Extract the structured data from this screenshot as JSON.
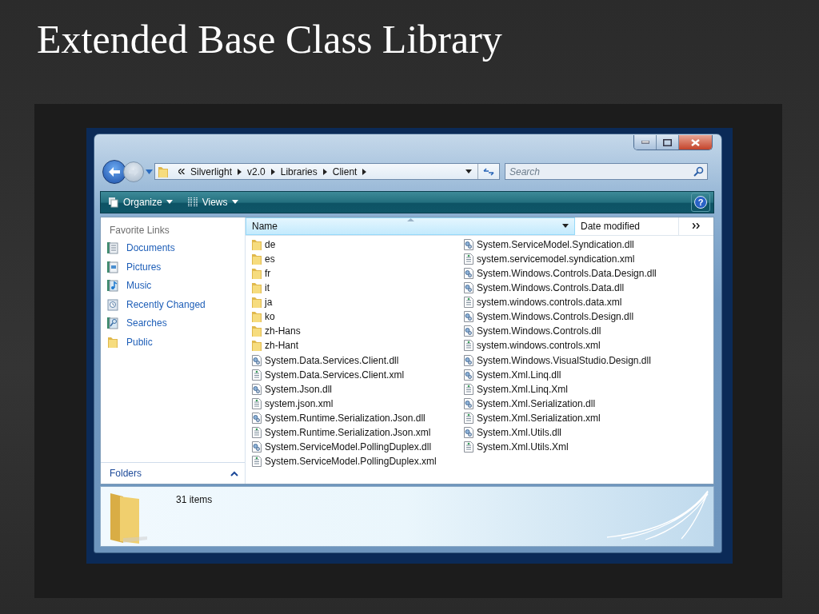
{
  "slide": {
    "title": "Extended Base Class Library"
  },
  "window": {
    "breadcrumb": [
      "Silverlight",
      "v2.0",
      "Libraries",
      "Client"
    ],
    "search": {
      "placeholder": "Search"
    },
    "help_label": "?",
    "toolbar": [
      {
        "label": "Organize",
        "kind": "organize"
      },
      {
        "label": "Views",
        "kind": "views"
      }
    ],
    "favorite_links": {
      "title": "Favorite Links",
      "items": [
        {
          "label": "Documents",
          "kind": "documents"
        },
        {
          "label": "Pictures",
          "kind": "pictures"
        },
        {
          "label": "Music",
          "kind": "music"
        },
        {
          "label": "Recently Changed",
          "kind": "recent"
        },
        {
          "label": "Searches",
          "kind": "searches"
        },
        {
          "label": "Public",
          "kind": "public"
        }
      ]
    },
    "folders_label": "Folders",
    "columns": [
      {
        "label": "Name",
        "sorted": true
      },
      {
        "label": "Date modified",
        "sorted": false
      }
    ],
    "files": [
      {
        "name": "de",
        "kind": "folder"
      },
      {
        "name": "es",
        "kind": "folder"
      },
      {
        "name": "fr",
        "kind": "folder"
      },
      {
        "name": "it",
        "kind": "folder"
      },
      {
        "name": "ja",
        "kind": "folder"
      },
      {
        "name": "ko",
        "kind": "folder"
      },
      {
        "name": "zh-Hans",
        "kind": "folder"
      },
      {
        "name": "zh-Hant",
        "kind": "folder"
      },
      {
        "name": "System.Data.Services.Client.dll",
        "kind": "dll"
      },
      {
        "name": "System.Data.Services.Client.xml",
        "kind": "xml"
      },
      {
        "name": "System.Json.dll",
        "kind": "dll"
      },
      {
        "name": "system.json.xml",
        "kind": "xml"
      },
      {
        "name": "System.Runtime.Serialization.Json.dll",
        "kind": "dll"
      },
      {
        "name": "System.Runtime.Serialization.Json.xml",
        "kind": "xml"
      },
      {
        "name": "System.ServiceModel.PollingDuplex.dll",
        "kind": "dll"
      },
      {
        "name": "System.ServiceModel.PollingDuplex.xml",
        "kind": "xml"
      },
      {
        "name": "System.ServiceModel.Syndication.dll",
        "kind": "dll"
      },
      {
        "name": "system.servicemodel.syndication.xml",
        "kind": "xml"
      },
      {
        "name": "System.Windows.Controls.Data.Design.dll",
        "kind": "dll"
      },
      {
        "name": "System.Windows.Controls.Data.dll",
        "kind": "dll"
      },
      {
        "name": "system.windows.controls.data.xml",
        "kind": "xml"
      },
      {
        "name": "System.Windows.Controls.Design.dll",
        "kind": "dll"
      },
      {
        "name": "System.Windows.Controls.dll",
        "kind": "dll"
      },
      {
        "name": "system.windows.controls.xml",
        "kind": "xml"
      },
      {
        "name": "System.Windows.VisualStudio.Design.dll",
        "kind": "dll"
      },
      {
        "name": "System.Xml.Linq.dll",
        "kind": "dll"
      },
      {
        "name": "System.Xml.Linq.Xml",
        "kind": "xml"
      },
      {
        "name": "System.Xml.Serialization.dll",
        "kind": "dll"
      },
      {
        "name": "System.Xml.Serialization.xml",
        "kind": "xml"
      },
      {
        "name": "System.Xml.Utils.dll",
        "kind": "dll"
      },
      {
        "name": "System.Xml.Utils.Xml",
        "kind": "xml"
      }
    ],
    "status": "31 items"
  }
}
